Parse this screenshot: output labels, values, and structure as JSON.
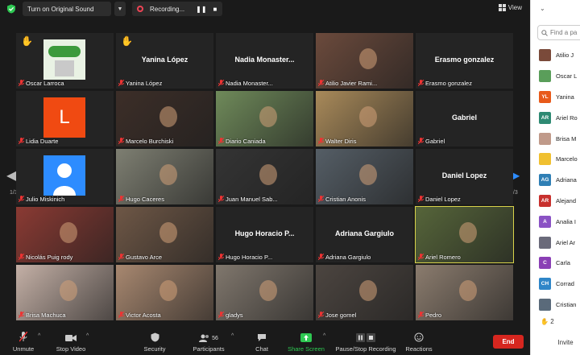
{
  "topbar": {
    "sound_button": "Turn on Original Sound",
    "recording_label": "Recording...",
    "view_label": "View"
  },
  "page_indicator": "1/3",
  "tiles": [
    {
      "name": "Oscar Larroca",
      "hand": true,
      "kind": "logo"
    },
    {
      "name": "Yanina López",
      "hand": true,
      "kind": "name"
    },
    {
      "name": "Nadia  Monaster...",
      "kind": "name"
    },
    {
      "name": "Atilio Javier Rami...",
      "kind": "video",
      "color": "#6b4a3c"
    },
    {
      "name": "Erasmo gonzalez",
      "kind": "name"
    },
    {
      "name": "Lidia Duarte",
      "kind": "letter",
      "letter": "L"
    },
    {
      "name": "Marcelo Burchiski",
      "kind": "video",
      "color": "#3c2e28"
    },
    {
      "name": "Diario Caniada",
      "kind": "video",
      "color": "#6f8a5a"
    },
    {
      "name": "Walter Diris",
      "kind": "video",
      "color": "#a98a5a"
    },
    {
      "name": "Gabriel",
      "kind": "name"
    },
    {
      "name": "Julio Miskinich",
      "kind": "person"
    },
    {
      "name": "Hugo Caceres",
      "kind": "video",
      "color": "#7e7f72"
    },
    {
      "name": "Juan Manuel Sab...",
      "kind": "video",
      "color": "#343434"
    },
    {
      "name": "Cristian Anonis",
      "kind": "video",
      "color": "#555e66"
    },
    {
      "name": "Daniel Lopez",
      "kind": "name"
    },
    {
      "name": "Nicolás Puig rody",
      "kind": "video",
      "color": "#8a3a33"
    },
    {
      "name": "Gustavo Arce",
      "kind": "video",
      "color": "#6e5746"
    },
    {
      "name": "Hugo  Horacio  P...",
      "kind": "name"
    },
    {
      "name": "Adriana Gargiulo",
      "kind": "name"
    },
    {
      "name": "Ariel Romero",
      "kind": "video",
      "color": "#56653a",
      "active": true
    },
    {
      "name": "Brisa Machuca",
      "kind": "video",
      "color": "#c4b0a6"
    },
    {
      "name": "Victor Acosta",
      "kind": "video",
      "color": "#a88870"
    },
    {
      "name": "gladys",
      "kind": "video",
      "color": "#80776d"
    },
    {
      "name": "Jose gomel",
      "kind": "video",
      "color": "#4c4540"
    },
    {
      "name": "Pedro",
      "kind": "video",
      "color": "#8b7c6e"
    }
  ],
  "toolbar": {
    "unmute": "Unmute",
    "stop_video": "Stop Video",
    "security": "Security",
    "participants": "Participants",
    "participants_count": "56",
    "chat": "Chat",
    "share_screen": "Share Screen",
    "pause_recording": "Pause/Stop Recording",
    "reactions": "Reactions",
    "end": "End"
  },
  "panel": {
    "search_placeholder": "Find a pa",
    "hand_count": "2",
    "invite": "Invite",
    "participants": [
      {
        "name": "Atilio J",
        "initials": "",
        "color": "#7a4a3a"
      },
      {
        "name": "Oscar L",
        "initials": "",
        "color": "#5a9e5a"
      },
      {
        "name": "Yanina",
        "initials": "YL",
        "color": "#e85a1a"
      },
      {
        "name": "Ariel Ro",
        "initials": "AR",
        "color": "#2e8a73"
      },
      {
        "name": "Brisa M",
        "initials": "",
        "color": "#c09a8a"
      },
      {
        "name": "Marcelo",
        "initials": "",
        "color": "#f0c030"
      },
      {
        "name": "Adriana",
        "initials": "AG",
        "color": "#2f7fb5"
      },
      {
        "name": "Alejand",
        "initials": "AR",
        "color": "#c8312e"
      },
      {
        "name": "Analia I",
        "initials": "A",
        "color": "#8a52c4"
      },
      {
        "name": "Ariel Ar",
        "initials": "",
        "color": "#6a6a7a"
      },
      {
        "name": "Carla",
        "initials": "C",
        "color": "#8a3fb5"
      },
      {
        "name": "Corrad",
        "initials": "CH",
        "color": "#2f86c8"
      },
      {
        "name": "Cristian",
        "initials": "",
        "color": "#5a6a7a"
      }
    ]
  }
}
